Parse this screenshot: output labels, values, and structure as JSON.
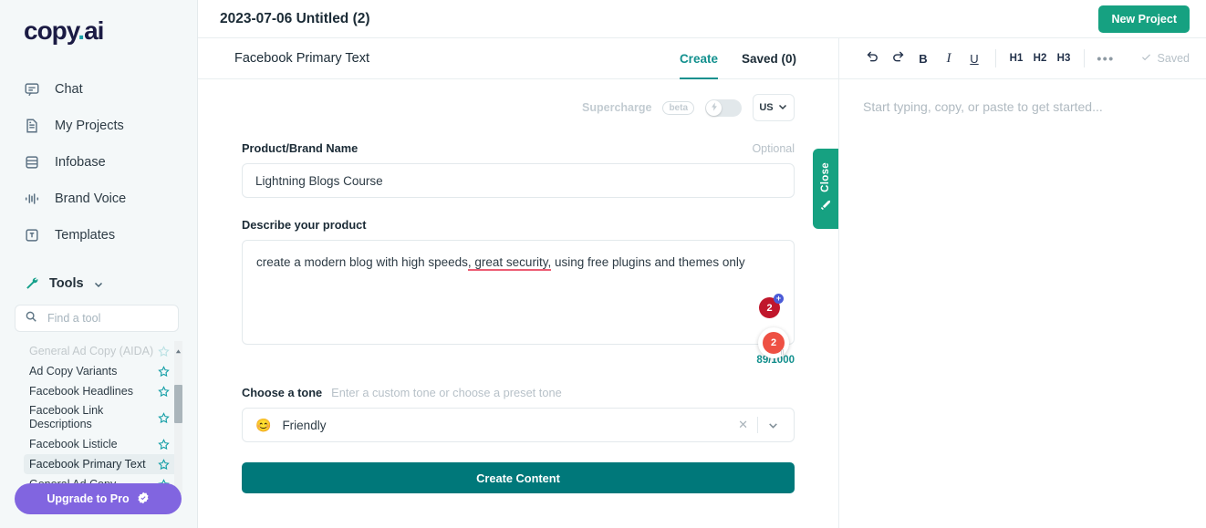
{
  "brand": {
    "logo_main": "copy",
    "logo_dot": ".",
    "logo_suffix": "ai"
  },
  "sidebar": {
    "nav": [
      {
        "label": "Chat",
        "icon": "chat-icon"
      },
      {
        "label": "My Projects",
        "icon": "document-icon"
      },
      {
        "label": "Infobase",
        "icon": "database-icon"
      },
      {
        "label": "Brand Voice",
        "icon": "audio-bars-icon"
      },
      {
        "label": "Templates",
        "icon": "template-icon"
      }
    ],
    "tools_section": {
      "label": "Tools",
      "icon": "wrench-icon",
      "chevron": "chevron-down-icon"
    },
    "search": {
      "placeholder": "Find a tool",
      "value": "",
      "icon": "search-icon"
    },
    "tools": [
      {
        "label": "General Ad Copy (AIDA)",
        "partial": true,
        "active": false,
        "bolt": false
      },
      {
        "label": "Ad Copy Variants",
        "partial": false,
        "active": false,
        "bolt": false
      },
      {
        "label": "Facebook Headlines",
        "partial": false,
        "active": false,
        "bolt": false
      },
      {
        "label": "Facebook Link Descriptions",
        "partial": false,
        "active": false,
        "bolt": false
      },
      {
        "label": "Facebook Listicle",
        "partial": false,
        "active": false,
        "bolt": false
      },
      {
        "label": "Facebook Primary Text",
        "partial": false,
        "active": true,
        "bolt": true
      },
      {
        "label": "General Ad Copy",
        "partial": false,
        "active": false,
        "bolt": false
      }
    ],
    "upgrade": {
      "label": "Upgrade to Pro",
      "icon": "verified-badge-icon",
      "color": "#8165e0"
    }
  },
  "header": {
    "doc_title": "2023-07-06 Untitled (2)",
    "new_project_label": "New Project",
    "new_project_color": "#16a181"
  },
  "form": {
    "tool_title": "Facebook Primary Text",
    "tabs": [
      {
        "label": "Create",
        "active": true
      },
      {
        "label": "Saved (0)",
        "active": false
      }
    ],
    "accent_color": "#12908e",
    "supercharge": {
      "label": "Supercharge",
      "badge": "beta",
      "toggle_on": false,
      "toggle_icon": "lightning-bolt-icon",
      "language": "US",
      "language_chevron": "chevron-down-icon"
    },
    "brand_field": {
      "label": "Product/Brand Name",
      "optional": "Optional",
      "value": "Lightning Blogs Course",
      "placeholder": ""
    },
    "describe_field": {
      "label": "Describe your product",
      "value": "create a modern blog with high speeds, great security, using free plugins and themes only",
      "placeholder": "",
      "text_part_1": "create a modern blog with high speeds",
      "text_part_2": ", great security,",
      "text_part_3": " using free plugins and themes only",
      "counter": "89/1000",
      "grammar_badge_count": "2",
      "grammar_badge_plus": "+",
      "grammar_float_count": "2"
    },
    "tone": {
      "label": "Choose a tone",
      "hint": "Enter a custom tone or choose a preset tone",
      "emoji": "😊",
      "value": "Friendly",
      "clear_icon": "close-x-icon",
      "chevron": "chevron-down-icon"
    },
    "submit": {
      "label": "Create Content",
      "color": "#00787a"
    },
    "close_tab": {
      "label": "Close",
      "icon": "pencil-icon",
      "color": "#16a181"
    }
  },
  "editor": {
    "toolbar": [
      {
        "name": "undo",
        "glyph": "",
        "icon": "undo-icon"
      },
      {
        "name": "redo",
        "glyph": "",
        "icon": "redo-icon"
      },
      {
        "name": "bold",
        "glyph": "B",
        "icon": "bold-icon"
      },
      {
        "name": "italic",
        "glyph": "I",
        "icon": "italic-icon"
      },
      {
        "name": "underline",
        "glyph": "U",
        "icon": "underline-icon"
      },
      {
        "name": "h1",
        "glyph": "H1",
        "icon": "heading-1-icon"
      },
      {
        "name": "h2",
        "glyph": "H2",
        "icon": "heading-2-icon"
      },
      {
        "name": "h3",
        "glyph": "H3",
        "icon": "heading-3-icon"
      },
      {
        "name": "more",
        "glyph": "•••",
        "icon": "more-horizontal-icon"
      }
    ],
    "h1": "H1",
    "h2": "H2",
    "h3": "H3",
    "bold": "B",
    "italic": "I",
    "underline": "U",
    "more": "•••",
    "saved_label": "Saved",
    "saved_icon": "check-icon",
    "placeholder": "Start typing, copy, or paste to get started..."
  }
}
